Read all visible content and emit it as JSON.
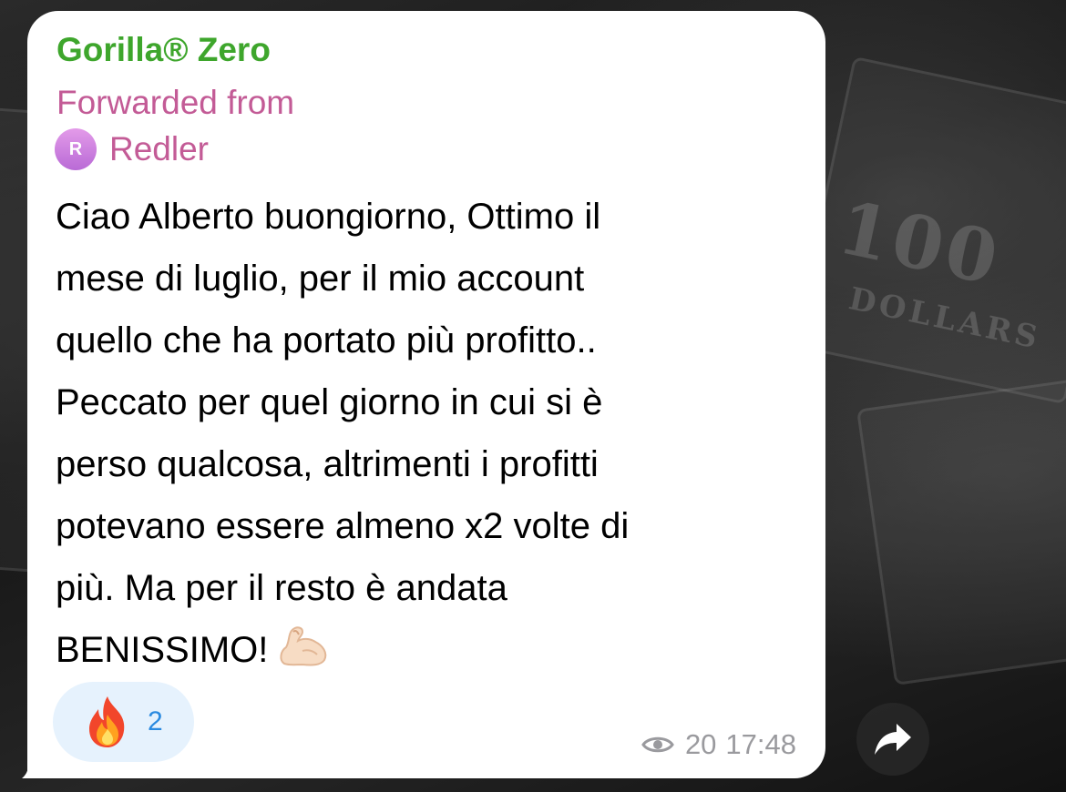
{
  "message": {
    "sender_name": "Gorilla® Zero",
    "forwarded_label": "Forwarded from",
    "origin": {
      "avatar_initial": "R",
      "name": "Redler"
    },
    "text_lines": [
      "Ciao Alberto buongiorno, Ottimo il",
      "mese di luglio, per il mio account",
      "quello che ha portato più profitto..",
      "Peccato per quel giorno in cui si è",
      "perso qualcosa, altrimenti i profitti",
      "potevano essere almeno x2 volte di",
      "più. Ma per il resto è andata",
      "BENISSIMO!"
    ],
    "trailing_emoji": "flexed-biceps-emoji",
    "reaction": {
      "emoji": "fire-emoji",
      "count": "2"
    },
    "views": "20",
    "time": "17:48"
  },
  "colors": {
    "sender": "#3ea62c",
    "forwarded": "#c35b96",
    "reaction_bg": "#e6f2fd",
    "reaction_count": "#2a8ae0",
    "meta": "#9a9a9e"
  },
  "icons": {
    "views": "eye-icon",
    "share": "share-arrow-icon"
  }
}
